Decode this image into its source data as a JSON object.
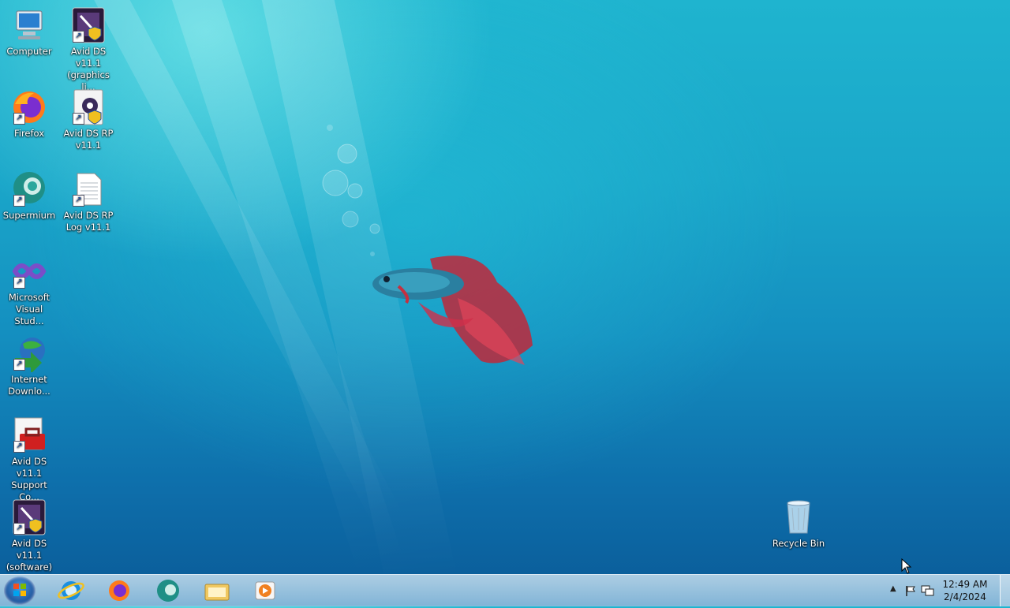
{
  "desktop": {
    "icons": [
      {
        "label": "Computer",
        "name": "computer-icon"
      },
      {
        "label": "Avid DS v11.1 (graphics li...",
        "name": "avid-graphics-icon"
      },
      {
        "label": "Firefox",
        "name": "firefox-icon"
      },
      {
        "label": "Avid DS RP v11.1",
        "name": "avid-rp-icon"
      },
      {
        "label": "Supermium",
        "name": "supermium-icon"
      },
      {
        "label": "Avid DS RP Log v11.1",
        "name": "text-document-icon"
      },
      {
        "label": "Microsoft Visual Stud...",
        "name": "visual-studio-icon"
      },
      {
        "label": "Internet Downlo...",
        "name": "internet-download-manager-icon"
      },
      {
        "label": "Avid DS v11.1 Support Co...",
        "name": "toolbox-icon"
      },
      {
        "label": "Avid DS v11.1 (software)",
        "name": "avid-software-icon"
      },
      {
        "label": "Recycle Bin",
        "name": "recycle-bin-icon"
      }
    ]
  },
  "taskbar": {
    "pinned": [
      "internet-explorer-icon",
      "firefox-icon",
      "supermium-icon",
      "file-explorer-icon",
      "media-player-icon"
    ],
    "clock_time": "12:49 AM",
    "clock_date": "2/4/2024"
  },
  "colors": {
    "taskbar": "#a8cde6",
    "accent": "#1b4f98"
  }
}
